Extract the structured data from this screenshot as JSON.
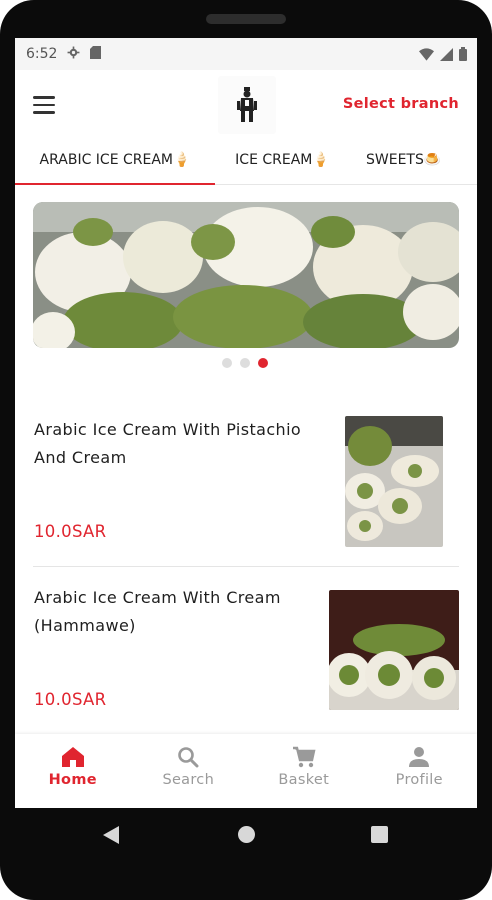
{
  "status": {
    "time": "6:52"
  },
  "header": {
    "branch_label": "Select branch"
  },
  "tabs": [
    {
      "label": "ARABIC ICE CREAM🍦"
    },
    {
      "label": "ICE CREAM🍦"
    },
    {
      "label": "SWEETS🍮"
    }
  ],
  "carousel": {
    "slide_count": 3,
    "active_index": 2
  },
  "products": [
    {
      "name": "Arabic Ice Cream With Pistachio And Cream",
      "price": "10.0SAR"
    },
    {
      "name": "Arabic Ice Cream With Cream (Hammawe)",
      "price": "10.0SAR"
    }
  ],
  "bottom_nav": [
    {
      "label": "Home",
      "icon": "home-icon",
      "active": true
    },
    {
      "label": "Search",
      "icon": "search-icon",
      "active": false
    },
    {
      "label": "Basket",
      "icon": "cart-icon",
      "active": false
    },
    {
      "label": "Profile",
      "icon": "person-icon",
      "active": false
    }
  ],
  "colors": {
    "accent": "#e0252f",
    "inactive": "#9a9a9a"
  }
}
